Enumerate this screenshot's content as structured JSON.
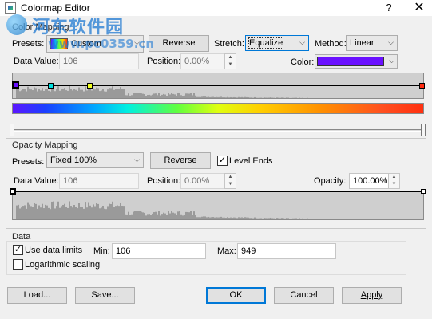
{
  "window": {
    "title": "Colormap Editor",
    "help": "?",
    "close": "✕"
  },
  "watermark": {
    "line1": "河东软件园",
    "line2": "www.pc0359.cn"
  },
  "color_mapping": {
    "group_label": "Color Mapping",
    "presets_label": "Presets:",
    "preset_value": "Custom",
    "reverse_label": "Reverse",
    "stretch_label": "Stretch:",
    "stretch_value": "Equalize",
    "method_label": "Method:",
    "method_value": "Linear",
    "data_value_label": "Data Value:",
    "data_value": "106",
    "position_label": "Position:",
    "position_value": "0.00%",
    "color_label": "Color:",
    "selected_color": "#6a10ff",
    "control_points": [
      {
        "pos": 0.0,
        "color": "#6a10ff"
      },
      {
        "pos": 0.095,
        "color": "#00e0e0"
      },
      {
        "pos": 0.19,
        "color": "#f0ff20"
      },
      {
        "pos": 1.0,
        "color": "#ff2a10"
      }
    ]
  },
  "opacity_mapping": {
    "group_label": "Opacity Mapping",
    "presets_label": "Presets:",
    "preset_value": "Fixed 100%",
    "reverse_label": "Reverse",
    "level_ends_label": "Level Ends",
    "level_ends_checked": true,
    "data_value_label": "Data Value:",
    "data_value": "106",
    "position_label": "Position:",
    "position_value": "0.00%",
    "opacity_label": "Opacity:",
    "opacity_value": "100.00%"
  },
  "data": {
    "group_label": "Data",
    "use_limits_label": "Use data limits",
    "use_limits_checked": true,
    "min_label": "Min:",
    "min_value": "106",
    "max_label": "Max:",
    "max_value": "949",
    "log_label": "Logarithmic scaling",
    "log_checked": false
  },
  "buttons": {
    "load": "Load...",
    "save": "Save...",
    "ok": "OK",
    "cancel": "Cancel",
    "apply": "Apply"
  },
  "colors": {
    "histogram": "#9a9a9a",
    "default_button_border": "#0078d7"
  }
}
